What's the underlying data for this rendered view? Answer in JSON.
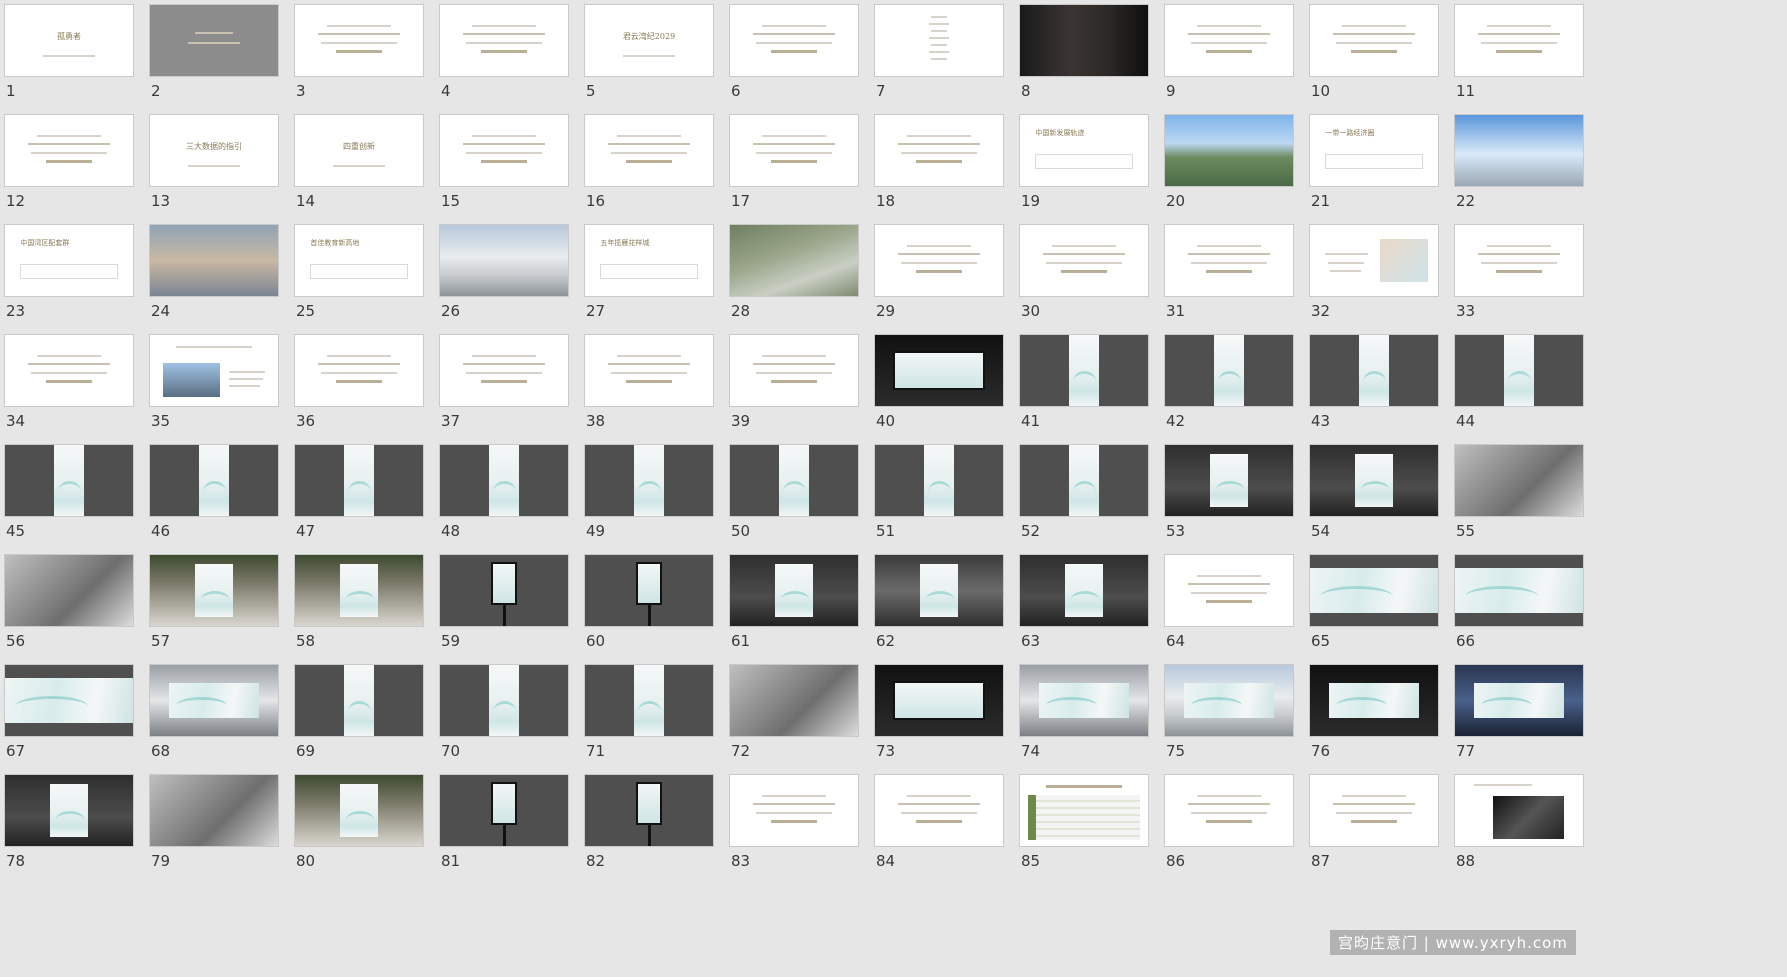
{
  "app": {
    "view": "slide-sorter"
  },
  "slides": [
    {
      "n": 1,
      "kind": "text",
      "title": "孤勇者"
    },
    {
      "n": 2,
      "kind": "gray"
    },
    {
      "n": 3,
      "kind": "text"
    },
    {
      "n": 4,
      "kind": "text"
    },
    {
      "n": 5,
      "kind": "text",
      "title": "君云湾纪2029"
    },
    {
      "n": 6,
      "kind": "text"
    },
    {
      "n": 7,
      "kind": "text-vertical"
    },
    {
      "n": 8,
      "kind": "photo",
      "photo": "man"
    },
    {
      "n": 9,
      "kind": "text"
    },
    {
      "n": 10,
      "kind": "text"
    },
    {
      "n": 11,
      "kind": "text"
    },
    {
      "n": 12,
      "kind": "text"
    },
    {
      "n": 13,
      "kind": "text",
      "title": "三大数据的指引"
    },
    {
      "n": 14,
      "kind": "text",
      "title": "四重创新"
    },
    {
      "n": 15,
      "kind": "text"
    },
    {
      "n": 16,
      "kind": "text"
    },
    {
      "n": 17,
      "kind": "text"
    },
    {
      "n": 18,
      "kind": "text"
    },
    {
      "n": 19,
      "kind": "text-box",
      "title": "中国新发展轨迹"
    },
    {
      "n": 20,
      "kind": "photo",
      "photo": "city"
    },
    {
      "n": 21,
      "kind": "text-box",
      "title": "一带一路经济圈"
    },
    {
      "n": 22,
      "kind": "photo",
      "photo": "sky"
    },
    {
      "n": 23,
      "kind": "text-box",
      "title": "中国湾区配套群"
    },
    {
      "n": 24,
      "kind": "photo",
      "photo": "plane"
    },
    {
      "n": 25,
      "kind": "text-box",
      "title": "首佳教育新高地"
    },
    {
      "n": 26,
      "kind": "photo",
      "photo": "building"
    },
    {
      "n": 27,
      "kind": "text-box",
      "title": "五年揽雁花样城"
    },
    {
      "n": 28,
      "kind": "photo",
      "photo": "aerial"
    },
    {
      "n": 29,
      "kind": "text"
    },
    {
      "n": 30,
      "kind": "text"
    },
    {
      "n": 31,
      "kind": "text"
    },
    {
      "n": 32,
      "kind": "text-map"
    },
    {
      "n": 33,
      "kind": "text"
    },
    {
      "n": 34,
      "kind": "text"
    },
    {
      "n": 35,
      "kind": "text-photo"
    },
    {
      "n": 36,
      "kind": "text"
    },
    {
      "n": 37,
      "kind": "text"
    },
    {
      "n": 38,
      "kind": "text"
    },
    {
      "n": 39,
      "kind": "text"
    },
    {
      "n": 40,
      "kind": "billboard-scene",
      "photo": "station"
    },
    {
      "n": 41,
      "kind": "dark-panel"
    },
    {
      "n": 42,
      "kind": "dark-panel"
    },
    {
      "n": 43,
      "kind": "dark-panel"
    },
    {
      "n": 44,
      "kind": "dark-panel"
    },
    {
      "n": 45,
      "kind": "dark-panel"
    },
    {
      "n": 46,
      "kind": "dark-panel"
    },
    {
      "n": 47,
      "kind": "dark-panel"
    },
    {
      "n": 48,
      "kind": "dark-panel"
    },
    {
      "n": 49,
      "kind": "dark-panel"
    },
    {
      "n": 50,
      "kind": "dark-panel"
    },
    {
      "n": 51,
      "kind": "dark-panel"
    },
    {
      "n": 52,
      "kind": "dark-panel"
    },
    {
      "n": 53,
      "kind": "photo-panel",
      "photo": "street"
    },
    {
      "n": 54,
      "kind": "photo-panel",
      "photo": "street"
    },
    {
      "n": 55,
      "kind": "photo",
      "photo": "gray"
    },
    {
      "n": 56,
      "kind": "photo",
      "photo": "gray"
    },
    {
      "n": 57,
      "kind": "photo-panel",
      "photo": "trees"
    },
    {
      "n": 58,
      "kind": "photo-panel",
      "photo": "trees"
    },
    {
      "n": 59,
      "kind": "kiosk"
    },
    {
      "n": 60,
      "kind": "kiosk"
    },
    {
      "n": 61,
      "kind": "photo-panel",
      "photo": "street"
    },
    {
      "n": 62,
      "kind": "photo-panel",
      "photo": "bus"
    },
    {
      "n": 63,
      "kind": "photo-panel",
      "photo": "street"
    },
    {
      "n": 64,
      "kind": "text"
    },
    {
      "n": 65,
      "kind": "dark-wide"
    },
    {
      "n": 66,
      "kind": "dark-wide"
    },
    {
      "n": 67,
      "kind": "dark-wide"
    },
    {
      "n": 68,
      "kind": "photo-wide",
      "photo": "mall"
    },
    {
      "n": 69,
      "kind": "dark-panel"
    },
    {
      "n": 70,
      "kind": "dark-panel"
    },
    {
      "n": 71,
      "kind": "dark-panel"
    },
    {
      "n": 72,
      "kind": "photo",
      "photo": "gray"
    },
    {
      "n": 73,
      "kind": "billboard-scene",
      "photo": "station"
    },
    {
      "n": 74,
      "kind": "photo-wide",
      "photo": "mall"
    },
    {
      "n": 75,
      "kind": "photo-wide",
      "photo": "building"
    },
    {
      "n": 76,
      "kind": "photo-wide",
      "photo": "station"
    },
    {
      "n": 77,
      "kind": "photo-wide",
      "photo": "night"
    },
    {
      "n": 78,
      "kind": "photo-panel",
      "photo": "street"
    },
    {
      "n": 79,
      "kind": "photo",
      "photo": "gray"
    },
    {
      "n": 80,
      "kind": "photo-panel",
      "photo": "trees"
    },
    {
      "n": 81,
      "kind": "kiosk"
    },
    {
      "n": 82,
      "kind": "kiosk"
    },
    {
      "n": 83,
      "kind": "text"
    },
    {
      "n": 84,
      "kind": "text"
    },
    {
      "n": 85,
      "kind": "text-table"
    },
    {
      "n": 86,
      "kind": "text"
    },
    {
      "n": 87,
      "kind": "text"
    },
    {
      "n": 88,
      "kind": "text-photo2"
    }
  ],
  "watermark": "宫昀庄意门 | www.yxryh.com"
}
